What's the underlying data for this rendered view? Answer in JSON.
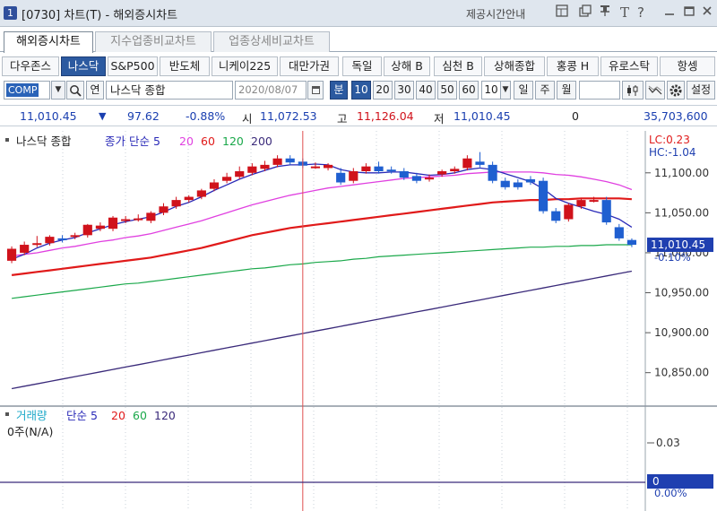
{
  "window": {
    "number": "1",
    "title": "[0730] 차트(T) - 해외증시차트",
    "help_label": "제공시간안내",
    "icons": [
      "layout-icon",
      "copy-icon",
      "pin-icon",
      "font-icon",
      "help-icon",
      "minimize-icon",
      "maximize-icon",
      "close-icon"
    ]
  },
  "main_tabs": [
    {
      "label": "해외증시차트",
      "active": true
    },
    {
      "label": "지수업종비교차트",
      "active": false
    },
    {
      "label": "업종상세비교차트",
      "active": false
    }
  ],
  "markets": [
    {
      "label": "다우존스",
      "active": false
    },
    {
      "label": "나스닥",
      "active": true
    },
    {
      "label": "S&P500",
      "active": false
    },
    {
      "label": "반도체",
      "active": false
    },
    {
      "label": "니케이225",
      "active": false
    },
    {
      "label": "대만가권",
      "active": false
    },
    {
      "label": "독일",
      "active": false
    },
    {
      "label": "상해 B",
      "active": false
    },
    {
      "label": "심천 B",
      "active": false
    },
    {
      "label": "상해종합",
      "active": false
    },
    {
      "label": "홍콩 H",
      "active": false
    },
    {
      "label": "유로스탁",
      "active": false
    },
    {
      "label": "항셍",
      "active": false
    }
  ],
  "toolbar": {
    "code": "COMP",
    "search_label": "Q",
    "link_label": "연",
    "name": "나스닥 종합",
    "date": "2020/08/07",
    "period_unit": "분",
    "minutes": [
      "10",
      "20",
      "30",
      "40",
      "50",
      "60"
    ],
    "minute_value": "10",
    "periods": [
      "일",
      "주",
      "월"
    ],
    "settings_label": "설정"
  },
  "quote": {
    "price": "11,010.45",
    "change": "97.62",
    "change_pct": "-0.88%",
    "open_label": "시",
    "open": "11,072.53",
    "high_label": "고",
    "high": "11,126.04",
    "low_label": "저",
    "low": "11,010.45",
    "middle_value": "0",
    "volume": "35,703,600"
  },
  "colors": {
    "up": "#d0121b",
    "down": "#1f5fd0",
    "ma5": "#2a2ab8",
    "ma20": "#e040e0",
    "ma60": "#e01a1a",
    "ma120": "#1aa84a",
    "ma200": "#3a2a7a",
    "price_highlight": "#1f3fb0"
  },
  "price_panel": {
    "legend_title": "나스닥 종합",
    "legend_type": "종가 단순 5",
    "ma_periods": [
      "20",
      "60",
      "120",
      "200"
    ],
    "lc_label": "LC:0.23",
    "hc_label": "HC:-1.04",
    "current_price_label": "11,010.45",
    "current_pct_label": "-0.10%"
  },
  "volume_panel": {
    "legend_title": "거래량",
    "legend_type": "단순 5",
    "ma_periods": [
      "20",
      "60",
      "120"
    ],
    "value_label": "0주(N/A)",
    "current_label": "0",
    "current_pct_label": "0.00%"
  },
  "chart_data": {
    "type": "candlestick",
    "title": "나스닥 종합",
    "y_ticks": [
      10850,
      10900,
      10950,
      11000,
      11050,
      11100
    ],
    "y_tick_labels": [
      "10,850.00",
      "10,900.00",
      "10,950.00",
      "11,000.00",
      "11,050.00",
      "11,100.00"
    ],
    "ylim": [
      10816,
      11148
    ],
    "candles": [
      {
        "o": 10990,
        "h": 11008,
        "c": 11005
      },
      {
        "o": 11000,
        "h": 11014,
        "c": 11010
      },
      {
        "o": 11010,
        "h": 11021,
        "c": 11012
      },
      {
        "o": 11012,
        "h": 11022,
        "c": 11020
      },
      {
        "o": 11018,
        "h": 11022,
        "c": 11016
      },
      {
        "o": 11020,
        "h": 11025,
        "c": 11022
      },
      {
        "o": 11022,
        "h": 11036,
        "c": 11035
      },
      {
        "o": 11030,
        "h": 11038,
        "c": 11034
      },
      {
        "o": 11030,
        "h": 11046,
        "c": 11044
      },
      {
        "o": 11040,
        "h": 11046,
        "c": 11042
      },
      {
        "o": 11042,
        "h": 11048,
        "c": 11043
      },
      {
        "o": 11040,
        "h": 11052,
        "c": 11050
      },
      {
        "o": 11050,
        "h": 11062,
        "c": 11058
      },
      {
        "o": 11058,
        "h": 11070,
        "c": 11066
      },
      {
        "o": 11066,
        "h": 11072,
        "c": 11070
      },
      {
        "o": 11070,
        "h": 11080,
        "c": 11078
      },
      {
        "o": 11080,
        "h": 11092,
        "c": 11088
      },
      {
        "o": 11090,
        "h": 11100,
        "c": 11095
      },
      {
        "o": 11095,
        "h": 11108,
        "c": 11102
      },
      {
        "o": 11100,
        "h": 11112,
        "c": 11108
      },
      {
        "o": 11105,
        "h": 11115,
        "c": 11110
      },
      {
        "o": 11110,
        "h": 11122,
        "c": 11118
      },
      {
        "o": 11118,
        "h": 11122,
        "c": 11113
      },
      {
        "o": 11114,
        "h": 11118,
        "c": 11109
      },
      {
        "o": 11108,
        "h": 11113,
        "c": 11108
      },
      {
        "o": 11106,
        "h": 11112,
        "c": 11110
      },
      {
        "o": 11100,
        "h": 11106,
        "c": 11088
      },
      {
        "o": 11090,
        "h": 11106,
        "c": 11102
      },
      {
        "o": 11102,
        "h": 11112,
        "c": 11108
      },
      {
        "o": 11108,
        "h": 11114,
        "c": 11102
      },
      {
        "o": 11104,
        "h": 11108,
        "c": 11102
      },
      {
        "o": 11102,
        "h": 11106,
        "c": 11094
      },
      {
        "o": 11096,
        "h": 11100,
        "c": 11090
      },
      {
        "o": 11092,
        "h": 11098,
        "c": 11094
      },
      {
        "o": 11098,
        "h": 11104,
        "c": 11102
      },
      {
        "o": 11102,
        "h": 11108,
        "c": 11105
      },
      {
        "o": 11106,
        "h": 11122,
        "c": 11118
      },
      {
        "o": 11114,
        "h": 11126,
        "c": 11110
      },
      {
        "o": 11110,
        "h": 11114,
        "c": 11090
      },
      {
        "o": 11090,
        "h": 11094,
        "c": 11082
      },
      {
        "o": 11088,
        "h": 11092,
        "c": 11082
      },
      {
        "o": 11092,
        "h": 11096,
        "c": 11088
      },
      {
        "o": 11090,
        "h": 11094,
        "c": 11052
      },
      {
        "o": 11052,
        "h": 11056,
        "c": 11040
      },
      {
        "o": 11042,
        "h": 11062,
        "c": 11060
      },
      {
        "o": 11058,
        "h": 11068,
        "c": 11066
      },
      {
        "o": 11066,
        "h": 11070,
        "c": 11066
      },
      {
        "o": 11066,
        "h": 11070,
        "c": 11038
      },
      {
        "o": 11032,
        "h": 11036,
        "c": 11018
      },
      {
        "o": 11016,
        "h": 11018,
        "c": 11010
      }
    ],
    "ma5": [
      10992,
      10998,
      11006,
      11012,
      11016,
      11019,
      11025,
      11030,
      11035,
      11039,
      11042,
      11045,
      11051,
      11058,
      11063,
      11070,
      11078,
      11085,
      11092,
      11098,
      11103,
      11108,
      11110,
      11110,
      11111,
      11110,
      11104,
      11101,
      11100,
      11100,
      11101,
      11101,
      11099,
      11097,
      11098,
      11100,
      11104,
      11106,
      11104,
      11099,
      11094,
      11089,
      11080,
      11068,
      11062,
      11057,
      11052,
      11048,
      11042,
      11032
    ],
    "ma20": [
      10996,
      10998,
      11000,
      11003,
      11006,
      11008,
      11011,
      11014,
      11016,
      11019,
      11021,
      11024,
      11028,
      11032,
      11036,
      11040,
      11045,
      11050,
      11055,
      11060,
      11064,
      11068,
      11072,
      11075,
      11078,
      11081,
      11083,
      11085,
      11087,
      11089,
      11091,
      11093,
      11094,
      11095,
      11096,
      11097,
      11099,
      11100,
      11101,
      11101,
      11101,
      11101,
      11100,
      11098,
      11097,
      11095,
      11092,
      11089,
      11085,
      11079
    ],
    "ma60": [
      10972,
      10974,
      10976,
      10978,
      10980,
      10982,
      10984,
      10986,
      10988,
      10990,
      10992,
      10994,
      10997,
      11000,
      11003,
      11006,
      11010,
      11014,
      11018,
      11022,
      11025,
      11028,
      11031,
      11033,
      11035,
      11037,
      11039,
      11041,
      11043,
      11045,
      11047,
      11049,
      11051,
      11053,
      11055,
      11057,
      11059,
      11061,
      11063,
      11064,
      11065,
      11066,
      11066,
      11067,
      11067,
      11068,
      11068,
      11068,
      11068,
      11067
    ],
    "ma120": [
      10943,
      10945,
      10947,
      10949,
      10951,
      10953,
      10955,
      10957,
      10959,
      10961,
      10962,
      10964,
      10966,
      10968,
      10970,
      10972,
      10974,
      10976,
      10978,
      10980,
      10981,
      10983,
      10985,
      10986,
      10988,
      10989,
      10990,
      10992,
      10993,
      10995,
      10996,
      10997,
      10998,
      10999,
      11000,
      11001,
      11002,
      11003,
      11004,
      11005,
      11006,
      11007,
      11007,
      11008,
      11008,
      11009,
      11009,
      11010,
      11010,
      11010
    ],
    "ma200": [
      10830,
      10833,
      10836,
      10839,
      10842,
      10845,
      10848,
      10851,
      10854,
      10857,
      10860,
      10863,
      10866,
      10869,
      10872,
      10875,
      10878,
      10881,
      10884,
      10887,
      10890,
      10893,
      10896,
      10899,
      10902,
      10905,
      10908,
      10911,
      10914,
      10917,
      10920,
      10923,
      10926,
      10929,
      10932,
      10935,
      10938,
      10941,
      10944,
      10947,
      10950,
      10953,
      10956,
      10959,
      10962,
      10965,
      10968,
      10971,
      10974,
      10977
    ],
    "cursor_index": 23,
    "volume": {
      "y_ticks": [
        0.03
      ],
      "y_tick_labels": [
        "0.03"
      ],
      "values": []
    }
  }
}
